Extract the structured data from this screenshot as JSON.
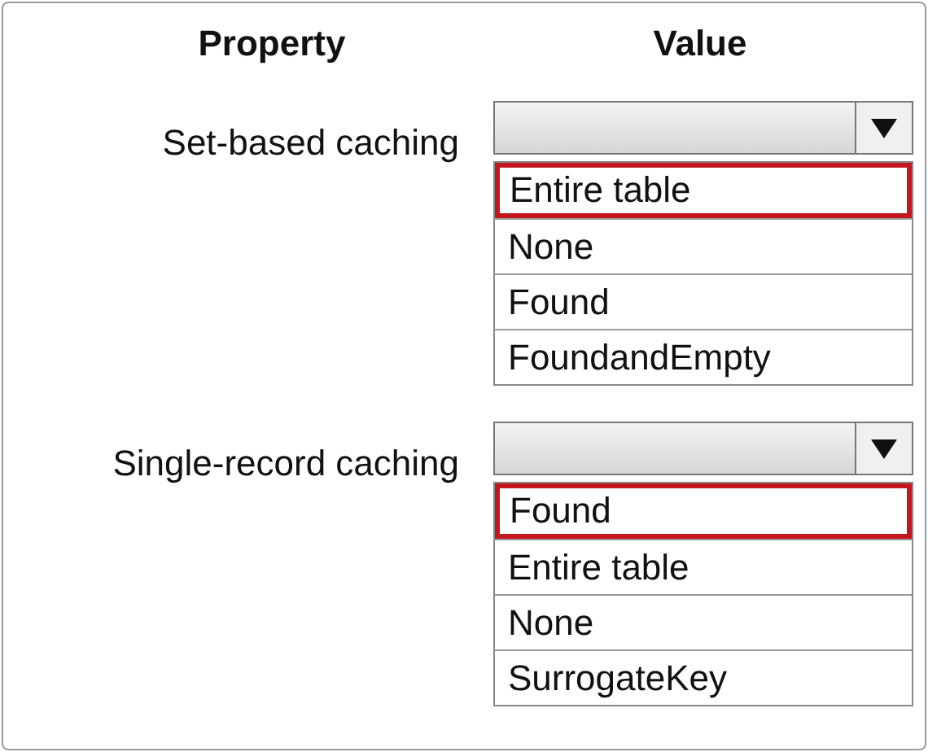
{
  "headers": [
    "Property",
    "Value"
  ],
  "properties": [
    {
      "label": "Set-based caching",
      "options": [
        {
          "label": "Entire table",
          "selected": true
        },
        {
          "label": "None",
          "selected": false
        },
        {
          "label": "Found",
          "selected": false
        },
        {
          "label": "FoundandEmpty",
          "selected": false
        }
      ]
    },
    {
      "label": "Single-record caching",
      "options": [
        {
          "label": "Found",
          "selected": true
        },
        {
          "label": "Entire table",
          "selected": false
        },
        {
          "label": "None",
          "selected": false
        },
        {
          "label": "SurrogateKey",
          "selected": false
        }
      ]
    }
  ]
}
